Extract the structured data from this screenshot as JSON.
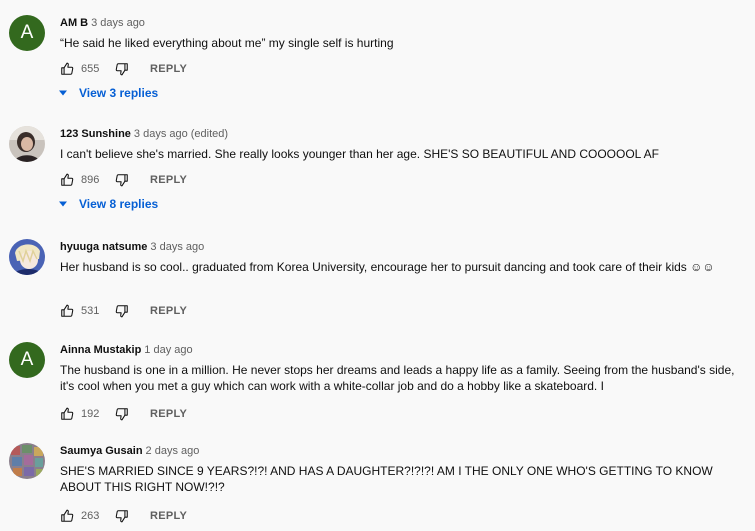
{
  "comments": [
    {
      "author": "AM B",
      "time": "3 days ago",
      "edited": "",
      "text": "“He said he liked everything about me” my single self is hurting",
      "likes": "655",
      "reply_label": "REPLY",
      "replies_label": "View 3 replies",
      "avatar_letter": "A",
      "avatar_color": "#33691e"
    },
    {
      "author": "123 Sunshine",
      "time": "3 days ago",
      "edited": "(edited)",
      "text": "I can't believe she's married. She really looks younger than her age. SHE'S SO BEAUTIFUL AND COOOOOL AF",
      "likes": "896",
      "reply_label": "REPLY",
      "replies_label": "View 8 replies"
    },
    {
      "author": "hyuuga natsume",
      "time": "3 days ago",
      "edited": "",
      "text": "Her husband is so cool.. graduated from Korea University, encourage her to pursuit dancing and took care of their kids ☺☺",
      "likes": "531",
      "reply_label": "REPLY"
    },
    {
      "author": "Ainna Mustakip",
      "time": "1 day ago",
      "edited": "",
      "text": "The husband is one in a million. He never stops her dreams and leads a happy life as a family. Seeing from the husband's side, it's cool when you met a guy which can work with a white-collar job and do a hobby like a skateboard. I",
      "likes": "192",
      "reply_label": "REPLY",
      "avatar_letter": "A",
      "avatar_color": "#33691e"
    },
    {
      "author": "Saumya Gusain",
      "time": "2 days ago",
      "edited": "",
      "text": "SHE'S MARRIED SINCE 9 YEARS?!?! AND HAS A DAUGHTER?!?!?! AM I THE ONLY ONE WHO'S GETTING TO KNOW ABOUT THIS RIGHT NOW!?!?",
      "likes": "263",
      "reply_label": "REPLY"
    }
  ],
  "colors": {
    "background": "#f9f9f9",
    "link_blue": "#065fd4",
    "secondary_text": "#606060"
  }
}
